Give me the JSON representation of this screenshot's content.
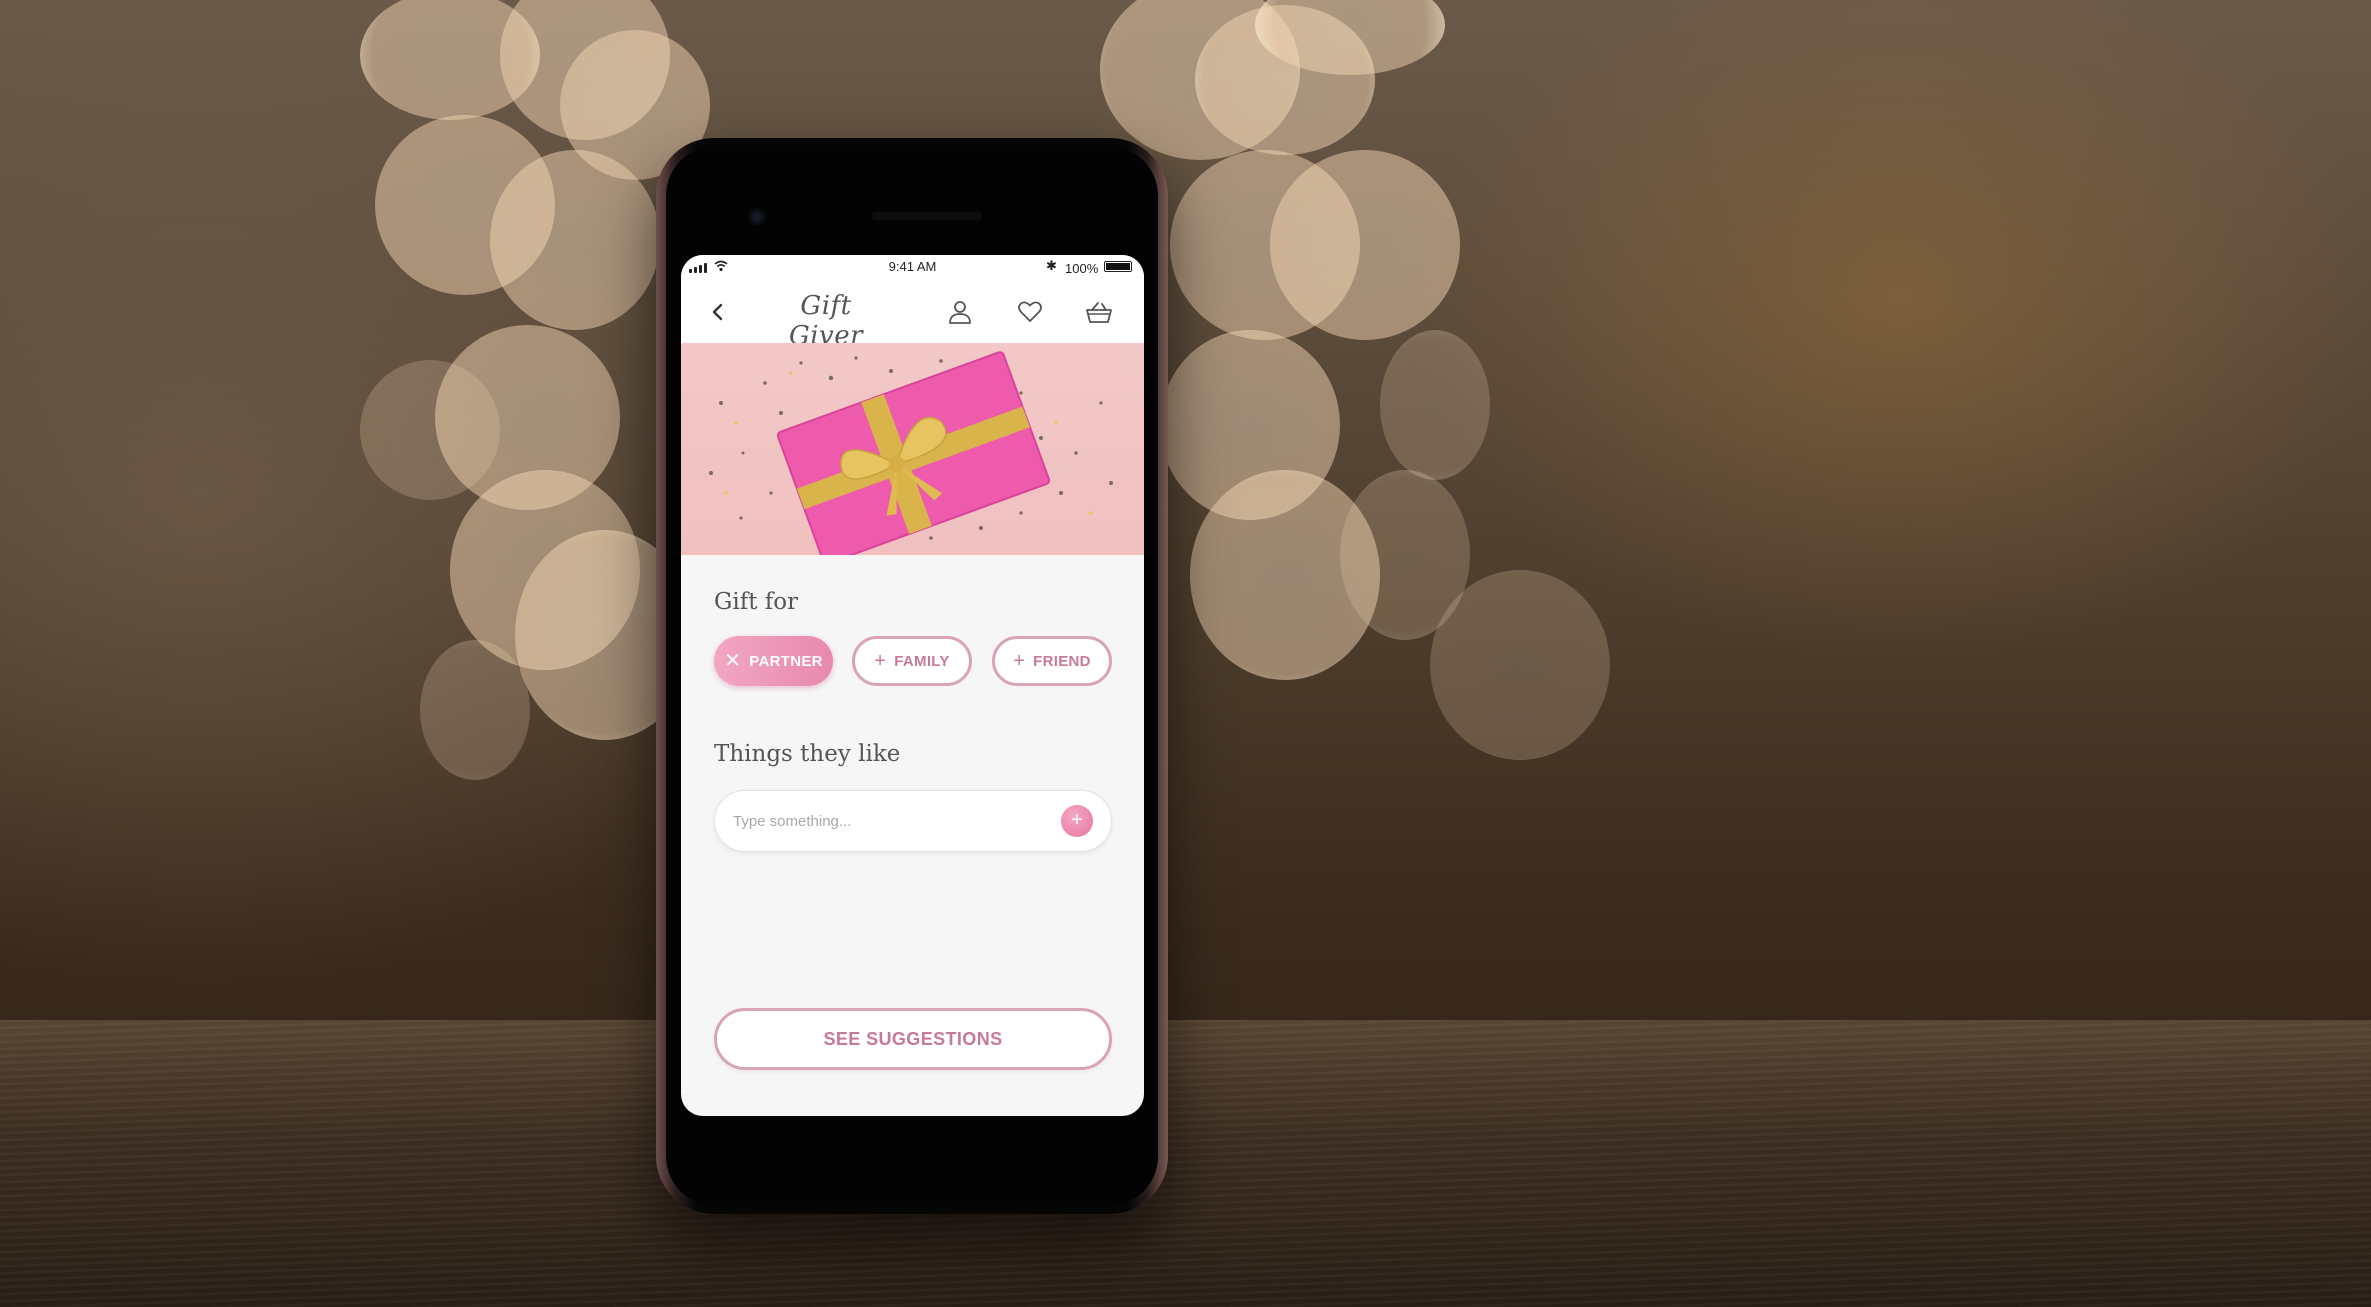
{
  "status_bar": {
    "time": "9:41 AM",
    "battery_percent": "100%",
    "bluetooth_glyph": "✱"
  },
  "nav": {
    "back_icon": "chevron-left-icon",
    "brand": "Gift Giver",
    "icons": [
      "user-icon",
      "heart-icon",
      "basket-icon"
    ]
  },
  "gift_for": {
    "title": "Gift for",
    "chips": [
      {
        "label": "PARTNER",
        "selected": true,
        "icon": "close-icon",
        "glyph": "✕"
      },
      {
        "label": "FAMILY",
        "selected": false,
        "icon": "plus-icon",
        "glyph": "+"
      },
      {
        "label": "FRIEND",
        "selected": false,
        "icon": "plus-icon",
        "glyph": "+"
      }
    ]
  },
  "likes": {
    "title": "Things they like",
    "placeholder": "Type something...",
    "value": "",
    "add_glyph": "+"
  },
  "cta": {
    "label": "SEE SUGGESTIONS"
  },
  "colors": {
    "accent_pink": "#e889ae",
    "outline_pink": "#d9a3b8",
    "text_pink": "#c7799a",
    "screen_bg": "#f6f6f6"
  }
}
